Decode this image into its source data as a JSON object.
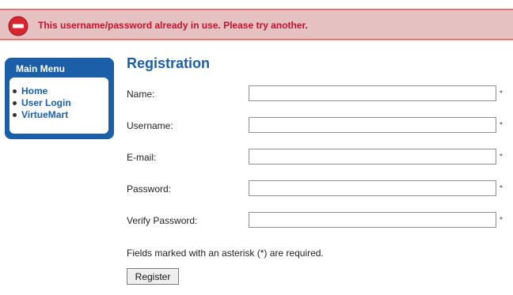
{
  "alert": {
    "icon": "no-entry-icon",
    "message": "This username/password already in use. Please try another.",
    "color": "#c8102e"
  },
  "menu": {
    "title": "Main Menu",
    "items": [
      "Home",
      "User Login",
      "VirtueMart"
    ],
    "color": "#1b5fa9"
  },
  "form": {
    "title": "Registration",
    "fields": [
      {
        "label": "Name:",
        "value": "",
        "required_marker": "*"
      },
      {
        "label": "Username:",
        "value": "",
        "required_marker": "*"
      },
      {
        "label": "E-mail:",
        "value": "",
        "required_marker": "*"
      },
      {
        "label": "Password:",
        "value": "",
        "required_marker": "*"
      },
      {
        "label": "Verify Password:",
        "value": "",
        "required_marker": "*"
      }
    ],
    "note": "Fields marked with an asterisk (*) are required.",
    "submit_label": "Register"
  }
}
